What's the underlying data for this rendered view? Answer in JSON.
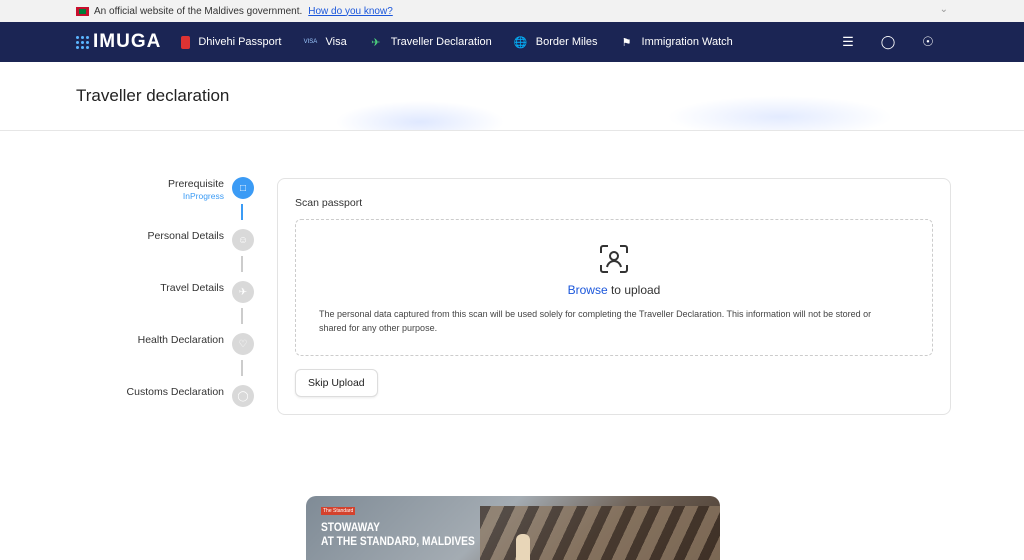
{
  "gov_bar": {
    "notice": "An official website of the Maldives government.",
    "link": "How do you know?"
  },
  "nav": {
    "logo": "IMUGA",
    "items": [
      {
        "label": "Dhivehi Passport",
        "icon": "passport-icon"
      },
      {
        "label": "Visa",
        "icon": "visa-icon"
      },
      {
        "label": "Traveller Declaration",
        "icon": "plane-icon"
      },
      {
        "label": "Border Miles",
        "icon": "globe-icon"
      },
      {
        "label": "Immigration Watch",
        "icon": "flag-icon"
      }
    ],
    "right_icons": [
      "menu-icon",
      "chat-icon",
      "language-icon"
    ]
  },
  "page": {
    "title": "Traveller declaration"
  },
  "stepper": {
    "steps": [
      {
        "label": "Prerequisite",
        "status": "InProgress",
        "active": true
      },
      {
        "label": "Personal Details",
        "status": "",
        "active": false
      },
      {
        "label": "Travel Details",
        "status": "",
        "active": false
      },
      {
        "label": "Health Declaration",
        "status": "",
        "active": false
      },
      {
        "label": "Customs Declaration",
        "status": "",
        "active": false
      }
    ]
  },
  "scan": {
    "title": "Scan passport",
    "browse": "Browse",
    "upload_text": " to upload",
    "description": "The personal data captured from this scan will be used solely for completing the Traveller Declaration. This information will not be stored or shared for any other purpose.",
    "skip_button": "Skip Upload"
  },
  "banner": {
    "tag": "The Standard",
    "title_line1": "STOWAWAY",
    "title_line2": "AT THE STANDARD, MALDIVES"
  },
  "colors": {
    "nav_bg": "#1b2554",
    "accent": "#3b9bf5",
    "link": "#1a56db"
  }
}
